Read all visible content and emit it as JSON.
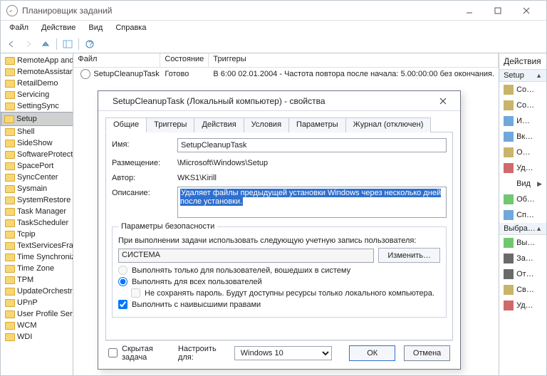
{
  "window": {
    "title": "Планировщик заданий"
  },
  "menubar": [
    "Файл",
    "Действие",
    "Вид",
    "Справка"
  ],
  "tree": [
    "RemoteApp and",
    "RemoteAssistanc",
    "RetailDemo",
    "Servicing",
    "SettingSync",
    "Setup",
    "Shell",
    "SideShow",
    "SoftwareProtecti",
    "SpacePort",
    "SyncCenter",
    "Sysmain",
    "SystemRestore",
    "Task Manager",
    "TaskScheduler",
    "Tcpip",
    "TextServicesFram",
    "Time Synchroniza",
    "Time Zone",
    "TPM",
    "UpdateOrchestra",
    "UPnP",
    "User Profile Serv",
    "WCM",
    "WDI"
  ],
  "tree_selected": "Setup",
  "list": {
    "cols": [
      "Файл",
      "Состояние",
      "Триггеры"
    ],
    "row": {
      "name": "SetupCleanupTask",
      "state": "Готово",
      "trigger": "В 6:00 02.01.2004 - Частота повтора после начала: 5.00:00:00 без окончания."
    }
  },
  "actions": {
    "title": "Действия",
    "group1": "Setup",
    "items1": [
      "Со…",
      "Со…",
      "И…",
      "Вк…",
      "О…",
      "Уд…"
    ],
    "view": "Вид",
    "items2": [
      "Об…",
      "Сп…"
    ],
    "group2": "Выбра…",
    "items3": [
      "Вы…",
      "За…",
      "От…",
      "Св…",
      "Уд…"
    ]
  },
  "dialog": {
    "title": "SetupCleanupTask (Локальный компьютер) - свойства",
    "tabs": [
      "Общие",
      "Триггеры",
      "Действия",
      "Условия",
      "Параметры",
      "Журнал (отключен)"
    ],
    "labels": {
      "name": "Имя:",
      "location": "Размещение:",
      "author": "Автор:",
      "desc": "Описание:"
    },
    "name": "SetupCleanupTask",
    "location": "\\Microsoft\\Windows\\Setup",
    "author": "WKS1\\Kirill",
    "desc": "Удаляет файлы предыдущей установки Windows через несколько дней после установки.",
    "sec_legend": "Параметры безопасности",
    "sec_line": "При выполнении задачи использовать следующую учетную запись пользователя:",
    "account": "СИСТЕМА",
    "change": "Изменить…",
    "opt_only_logged": "Выполнять только для пользователей, вошедших в систему",
    "opt_all_users": "Выполнять для всех пользователей",
    "opt_no_store": "Не сохранять пароль. Будут доступны ресурсы только локального компьютера.",
    "opt_highest": "Выполнить с наивысшими правами",
    "hidden": "Скрытая задача",
    "config_for": "Настроить для:",
    "config_val": "Windows 10",
    "ok": "ОК",
    "cancel": "Отмена"
  }
}
